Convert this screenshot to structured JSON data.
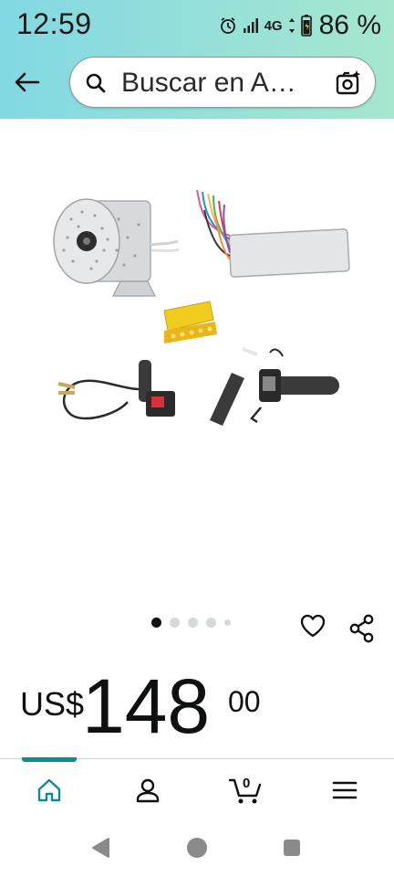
{
  "status_bar": {
    "time": "12:59",
    "network": "4G",
    "battery_percent": "86 %",
    "icons": [
      "alarm-icon",
      "signal-icon",
      "battery-icon"
    ]
  },
  "search": {
    "back_icon": "arrow-left-icon",
    "search_icon": "search-icon",
    "query_text": "Buscar en A…",
    "camera_icon": "camera-search-icon"
  },
  "product": {
    "image_icon": "product-photo",
    "carousel": {
      "total": 5,
      "active_index": 0
    },
    "actions": [
      "heart-icon",
      "share-icon"
    ]
  },
  "price": {
    "currency": "US$",
    "whole": "148",
    "fraction": "00"
  },
  "bottom_nav": {
    "items": [
      "home-icon",
      "account-icon",
      "cart-icon",
      "menu-icon"
    ],
    "active": "home",
    "cart_count": "0"
  },
  "system_nav": [
    "back-icon",
    "home-circle-icon",
    "recents-icon"
  ],
  "colors": {
    "header_start": "#82d8e3",
    "header_end": "#a6e7ce",
    "accent": "#0f8a9a",
    "text": "#0f1111"
  }
}
